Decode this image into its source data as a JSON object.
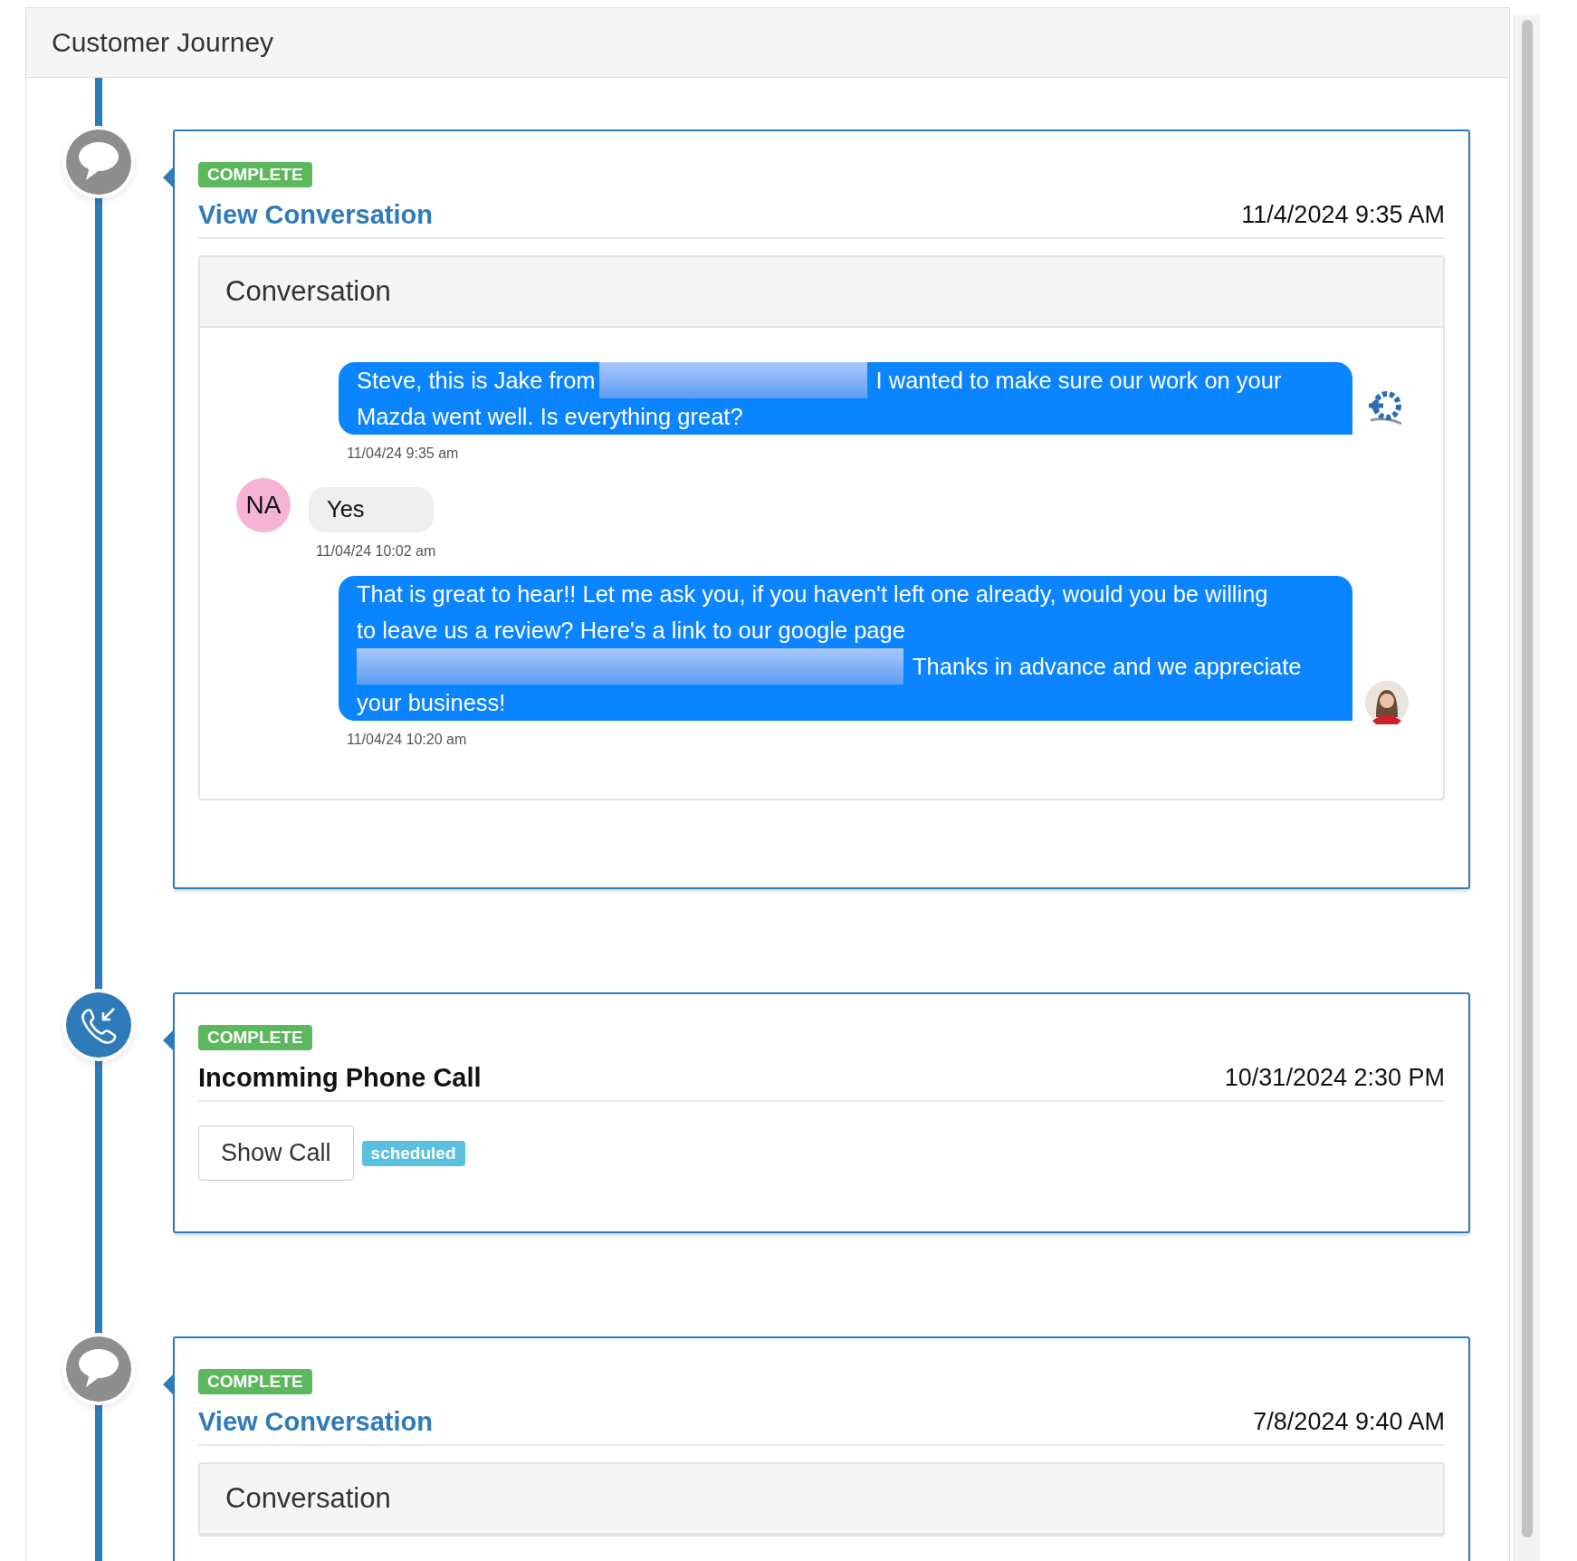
{
  "panel": {
    "title": "Customer Journey"
  },
  "events": [
    {
      "kind": "conversation",
      "status": "COMPLETE",
      "title": "View Conversation",
      "date": "11/4/2024 9:35 AM",
      "conversation": {
        "title": "Conversation",
        "messages": [
          {
            "kind": "outgoing",
            "avatar": {
              "kind": "logo"
            },
            "lines": [
              [
                {
                  "kind": "text",
                  "text": "Steve, this is Jake from"
                },
                {
                  "kind": "blur"
                },
                {
                  "kind": "text",
                  "text": "I wanted to make sure our work on your"
                }
              ],
              [
                {
                  "kind": "text",
                  "text": "Mazda went well. Is everything great?"
                }
              ]
            ],
            "time": "11/04/24 9:35 am"
          },
          {
            "kind": "incoming",
            "avatar": {
              "kind": "initials",
              "text": "NA"
            },
            "lines": [
              [
                {
                  "kind": "text",
                  "text": "Yes"
                }
              ]
            ],
            "time": "11/04/24 10:02 am"
          },
          {
            "kind": "outgoing",
            "avatar": {
              "kind": "photo"
            },
            "lines": [
              [
                {
                  "kind": "text",
                  "text": "That is great to hear!! Let me ask you, if you haven't left one already, would you be willing"
                }
              ],
              [
                {
                  "kind": "text",
                  "text": "to leave us a review? Here's a link to our google page"
                }
              ],
              [
                {
                  "kind": "wideblur"
                },
                {
                  "kind": "text",
                  "text": "Thanks in advance and we appreciate"
                }
              ],
              [
                {
                  "kind": "text",
                  "text": "your business!"
                }
              ]
            ],
            "time": "11/04/24 10:20 am"
          }
        ]
      }
    },
    {
      "kind": "call",
      "status": "COMPLETE",
      "title": "Incomming Phone Call",
      "date": "10/31/2024 2:30 PM",
      "button": "Show Call",
      "tag": "scheduled"
    },
    {
      "kind": "conversation",
      "status": "COMPLETE",
      "title": "View Conversation",
      "date": "7/8/2024 9:40 AM",
      "conversation": {
        "title": "Conversation"
      }
    }
  ]
}
